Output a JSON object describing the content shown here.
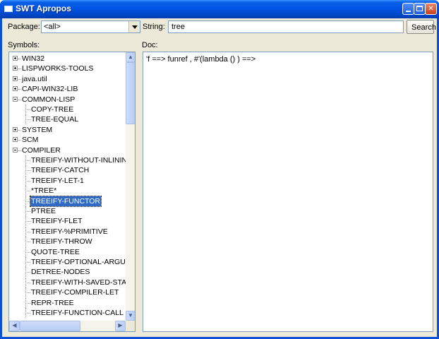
{
  "window": {
    "title": "SWT Apropos",
    "controls": [
      "minimize-icon",
      "maximize-icon",
      "close-icon"
    ]
  },
  "toolbar": {
    "package_label": "Package:",
    "package_value": "<all>",
    "string_label": "String:",
    "string_value": "tree",
    "search_label": "Search"
  },
  "symbols": {
    "label": "Symbols:",
    "items": [
      {
        "text": "WIN32",
        "level": 0,
        "expandable": true,
        "expanded": false,
        "selected": false
      },
      {
        "text": "LISPWORKS-TOOLS",
        "level": 0,
        "expandable": true,
        "expanded": false,
        "selected": false
      },
      {
        "text": "java.util",
        "level": 0,
        "expandable": true,
        "expanded": false,
        "selected": false
      },
      {
        "text": "CAPI-WIN32-LIB",
        "level": 0,
        "expandable": true,
        "expanded": false,
        "selected": false
      },
      {
        "text": "COMMON-LISP",
        "level": 0,
        "expandable": true,
        "expanded": true,
        "selected": false
      },
      {
        "text": "COPY-TREE",
        "level": 1,
        "expandable": false,
        "expanded": false,
        "selected": false
      },
      {
        "text": "TREE-EQUAL",
        "level": 1,
        "expandable": false,
        "expanded": false,
        "selected": false
      },
      {
        "text": "SYSTEM",
        "level": 0,
        "expandable": true,
        "expanded": false,
        "selected": false
      },
      {
        "text": "SCM",
        "level": 0,
        "expandable": true,
        "expanded": false,
        "selected": false
      },
      {
        "text": "COMPILER",
        "level": 0,
        "expandable": true,
        "expanded": true,
        "selected": false
      },
      {
        "text": "TREEIFY-WITHOUT-INLINING",
        "level": 1,
        "expandable": false,
        "expanded": false,
        "selected": false
      },
      {
        "text": "TREEIFY-CATCH",
        "level": 1,
        "expandable": false,
        "expanded": false,
        "selected": false
      },
      {
        "text": "TREEIFY-LET-1",
        "level": 1,
        "expandable": false,
        "expanded": false,
        "selected": false
      },
      {
        "text": "*TREE*",
        "level": 1,
        "expandable": false,
        "expanded": false,
        "selected": false
      },
      {
        "text": "TREEIFY-FUNCTOR",
        "level": 1,
        "expandable": false,
        "expanded": false,
        "selected": true
      },
      {
        "text": "PTREE",
        "level": 1,
        "expandable": false,
        "expanded": false,
        "selected": false
      },
      {
        "text": "TREEIFY-FLET",
        "level": 1,
        "expandable": false,
        "expanded": false,
        "selected": false
      },
      {
        "text": "TREEIFY-%PRIMITIVE",
        "level": 1,
        "expandable": false,
        "expanded": false,
        "selected": false
      },
      {
        "text": "TREEIFY-THROW",
        "level": 1,
        "expandable": false,
        "expanded": false,
        "selected": false
      },
      {
        "text": "QUOTE-TREE",
        "level": 1,
        "expandable": false,
        "expanded": false,
        "selected": false
      },
      {
        "text": "TREEIFY-OPTIONAL-ARGUMEN",
        "level": 1,
        "expandable": false,
        "expanded": false,
        "selected": false
      },
      {
        "text": "DETREE-NODES",
        "level": 1,
        "expandable": false,
        "expanded": false,
        "selected": false
      },
      {
        "text": "TREEIFY-WITH-SAVED-STACK",
        "level": 1,
        "expandable": false,
        "expanded": false,
        "selected": false
      },
      {
        "text": "TREEIFY-COMPILER-LET",
        "level": 1,
        "expandable": false,
        "expanded": false,
        "selected": false
      },
      {
        "text": "REPR-TREE",
        "level": 1,
        "expandable": false,
        "expanded": false,
        "selected": false
      },
      {
        "text": "TREEIFY-FUNCTION-CALL",
        "level": 1,
        "expandable": false,
        "expanded": false,
        "selected": false
      }
    ]
  },
  "doc": {
    "label": "Doc:",
    "text": "'f ==> funref , #'(lambda () ) ==>"
  },
  "colors": {
    "titlebar": "#0055e5",
    "window_bg": "#ece9d8",
    "selection": "#316ac5",
    "border": "#7f9db9"
  }
}
